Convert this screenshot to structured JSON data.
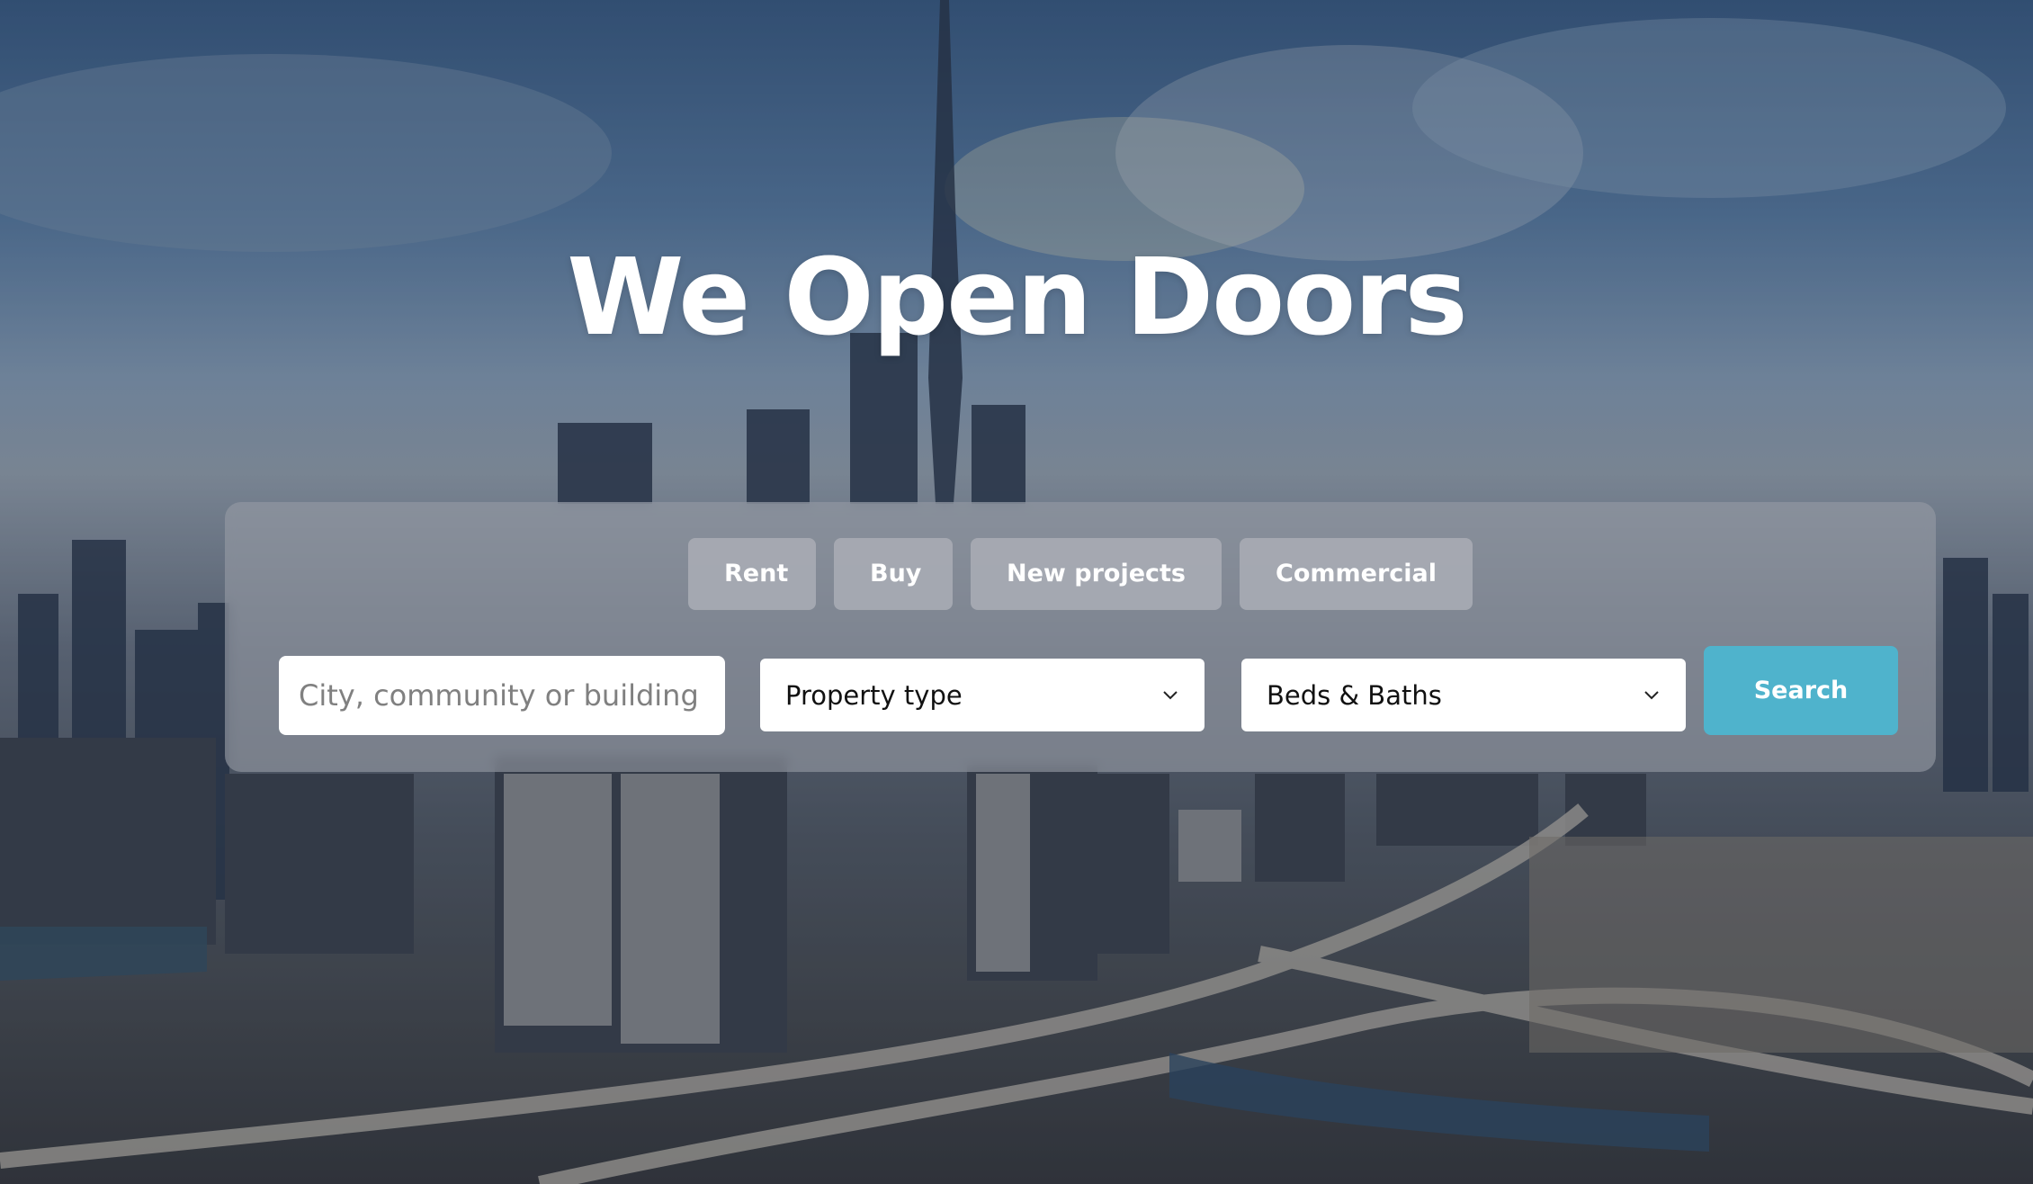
{
  "hero": {
    "headline": "We Open Doors",
    "background_image": "dubai-skyline-aerial"
  },
  "search": {
    "tabs": [
      {
        "label": "Rent"
      },
      {
        "label": "Buy"
      },
      {
        "label": "New projects"
      },
      {
        "label": "Commercial"
      }
    ],
    "location_input": {
      "placeholder": "City, community or building",
      "value": ""
    },
    "property_type": {
      "selected": "Property type"
    },
    "beds_baths": {
      "selected": "Beds & Baths"
    },
    "search_label": "Search"
  },
  "colors": {
    "search_button": "#4fb3cc",
    "panel": "#969ba5",
    "tab": "#aaaeb6",
    "headline": "#ffffff"
  },
  "icons": {
    "select_chevron": "chevron-down-icon"
  }
}
